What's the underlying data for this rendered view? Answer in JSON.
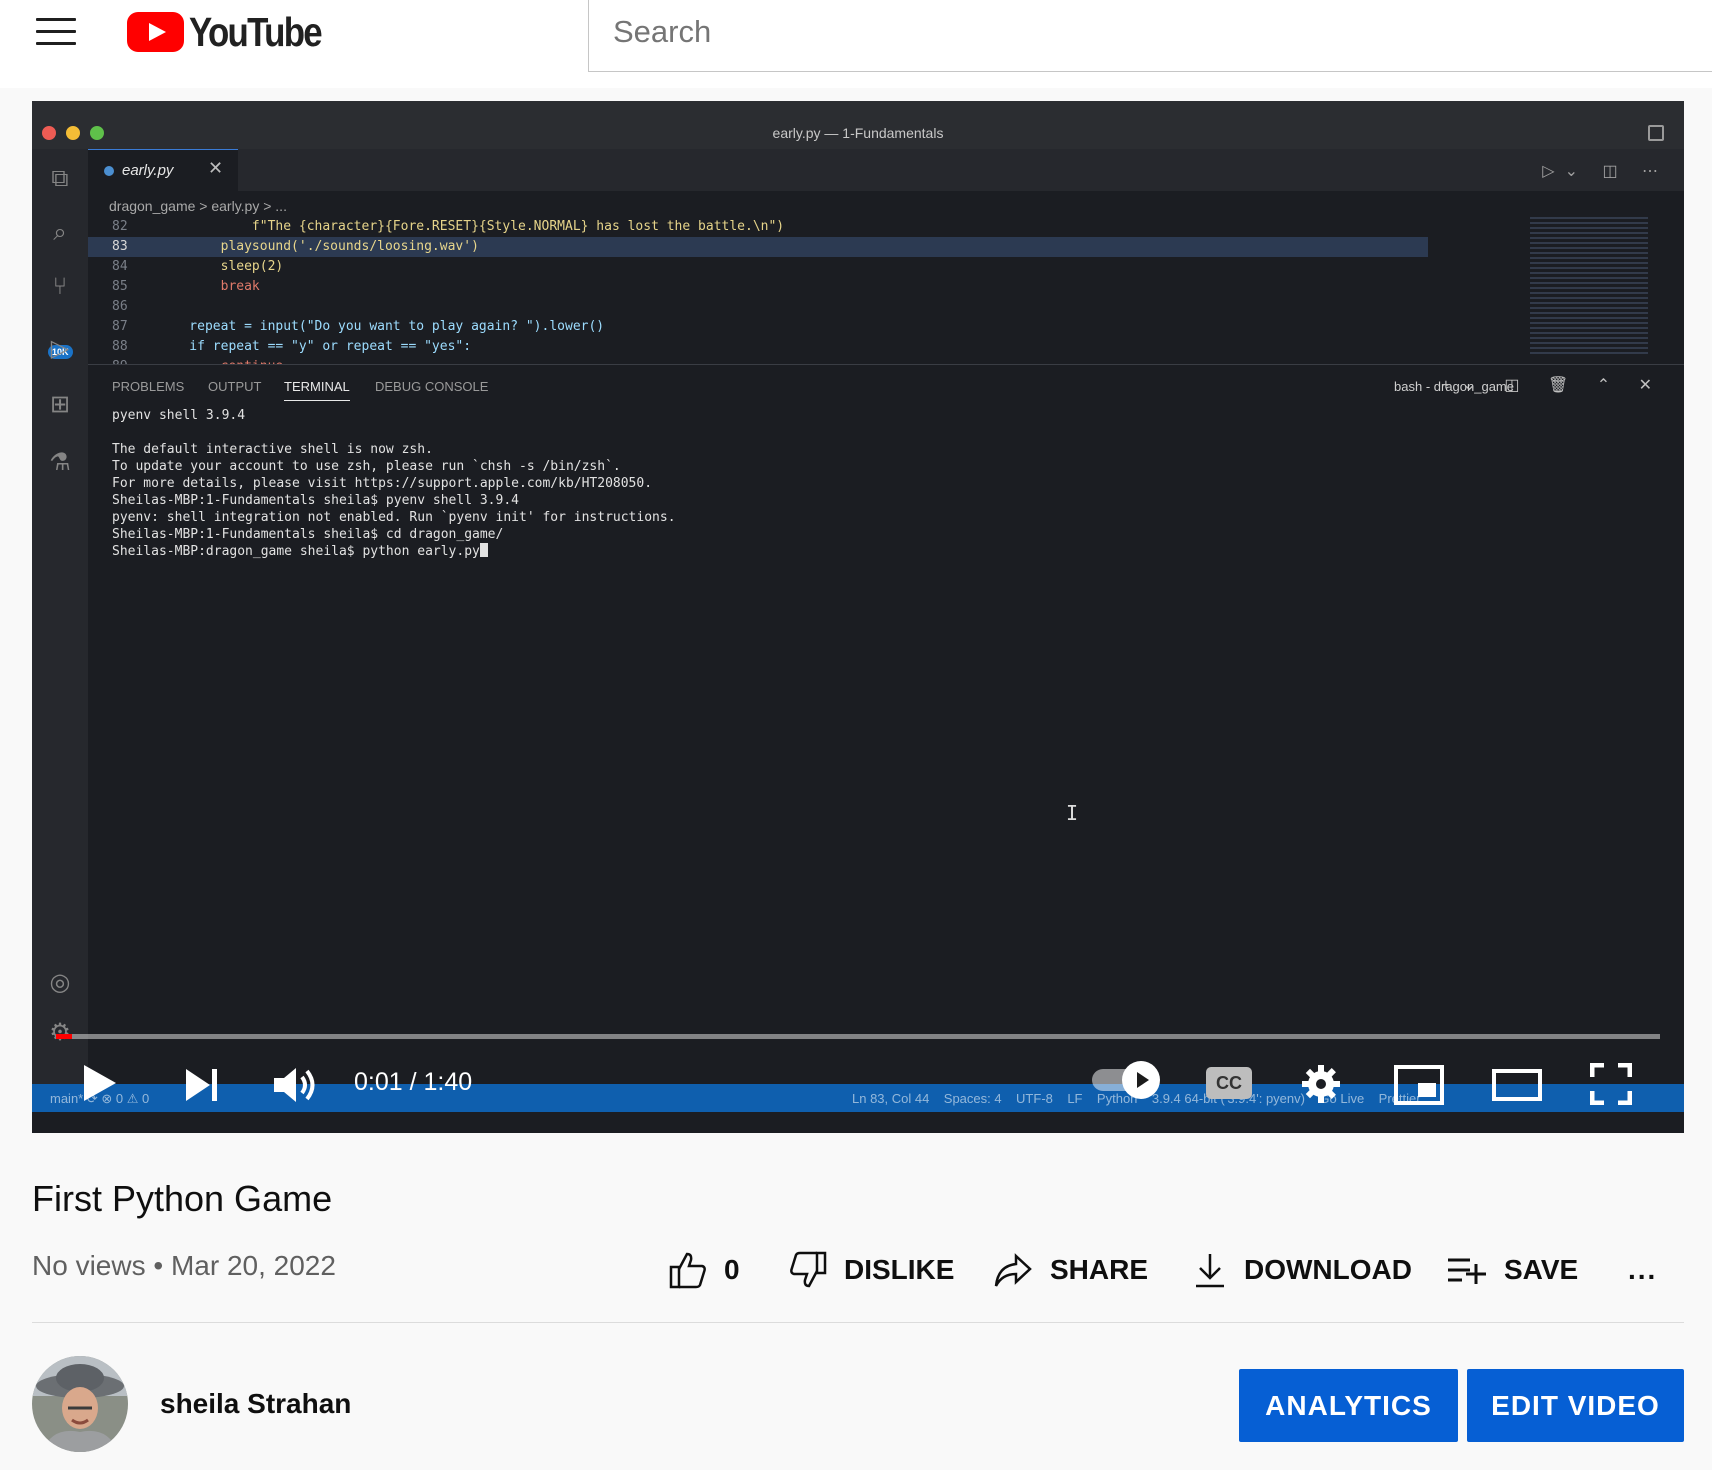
{
  "header": {
    "logo_text": "YouTube",
    "search_placeholder": "Search"
  },
  "player": {
    "current_time": "0:01",
    "duration": "1:40",
    "time_display": "0:01 / 1:40",
    "progress_fraction": 0.01,
    "cc_label": "CC",
    "autoplay_on": true
  },
  "vscode": {
    "window_title": "early.py — 1-Fundamentals",
    "active_tab": "early.py",
    "breadcrumbs": "dragon_game  >  early.py  > ...",
    "activity_badge": "10K",
    "code_lines": [
      {
        "num": "82",
        "text": "            f\"The {character}{Fore.RESET}{Style.NORMAL} has lost the battle.\\n\")"
      },
      {
        "num": "83",
        "text": "        playsound('./sounds/loosing.wav')"
      },
      {
        "num": "84",
        "text": "        sleep(2)"
      },
      {
        "num": "85",
        "text": "        break"
      },
      {
        "num": "86",
        "text": ""
      },
      {
        "num": "87",
        "text": "    repeat = input(\"Do you want to play again? \").lower()"
      },
      {
        "num": "88",
        "text": "    if repeat == \"y\" or repeat == \"yes\":"
      },
      {
        "num": "89",
        "text": "        continue"
      }
    ],
    "panel_tabs": [
      "PROBLEMS",
      "OUTPUT",
      "TERMINAL",
      "DEBUG CONSOLE"
    ],
    "terminal_name": "bash - dragon_game",
    "terminal_lines": [
      "pyenv shell 3.9.4",
      "",
      "The default interactive shell is now zsh.",
      "To update your account to use zsh, please run `chsh -s /bin/zsh`.",
      "For more details, please visit https://support.apple.com/kb/HT208050.",
      "Sheilas-MBP:1-Fundamentals sheila$ pyenv shell 3.9.4",
      "pyenv: shell integration not enabled. Run `pyenv init' for instructions.",
      "Sheilas-MBP:1-Fundamentals sheila$ cd dragon_game/",
      "Sheilas-MBP:dragon_game sheila$ python early.py"
    ],
    "status_left": "main*   ⟳   ⊗ 0 ⚠ 0",
    "status_right": "Ln 83, Col 44    Spaces: 4    UTF-8    LF    Python    3.9.4 64-bit ('3.9.4': pyenv)    Go Live    Prettier"
  },
  "video": {
    "title": "First Python Game",
    "views": "No views",
    "date": "Mar 20, 2022",
    "meta": "No views • Mar 20, 2022"
  },
  "actions": {
    "like_count": "0",
    "dislike": "DISLIKE",
    "share": "SHARE",
    "download": "DOWNLOAD",
    "save": "SAVE",
    "more": "..."
  },
  "channel": {
    "name": "sheila Strahan"
  },
  "buttons": {
    "analytics": "ANALYTICS",
    "edit_video": "EDIT VIDEO"
  },
  "colors": {
    "brand_red": "#ff0000",
    "button_blue": "#065fd4",
    "vscode_status": "#0f5fae"
  }
}
